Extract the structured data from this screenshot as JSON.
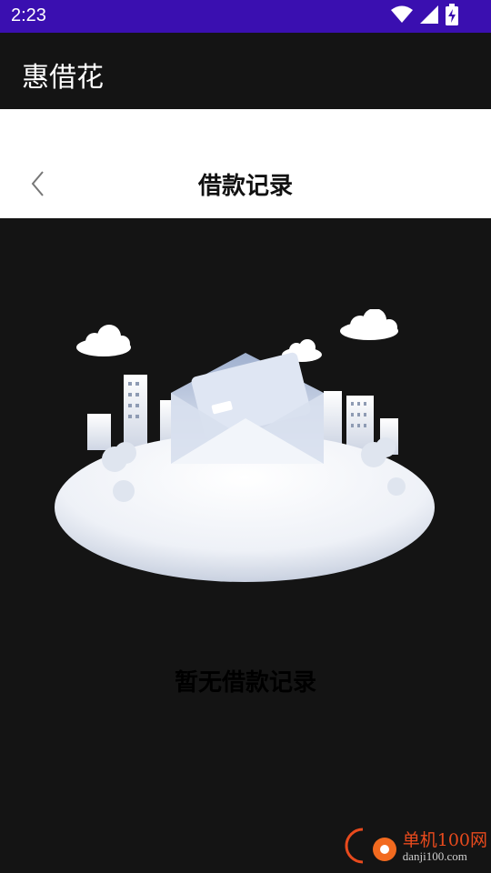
{
  "status_bar": {
    "time": "2:23",
    "icons": [
      "wifi-icon",
      "signal-icon",
      "battery-charging-icon"
    ]
  },
  "app_bar": {
    "title": "惠借花"
  },
  "nav": {
    "back_icon": "chevron-left-icon",
    "title": "借款记录"
  },
  "empty_state": {
    "illustration": "empty-envelope-city-illustration",
    "message": "暂无借款记录"
  },
  "watermark": {
    "name": "单机100网",
    "url": "danji100.com"
  },
  "colors": {
    "status_bar_bg": "#3a0fb0",
    "app_bg": "#141414",
    "nav_bg": "#ffffff",
    "watermark_accent": "#e84a1d"
  }
}
